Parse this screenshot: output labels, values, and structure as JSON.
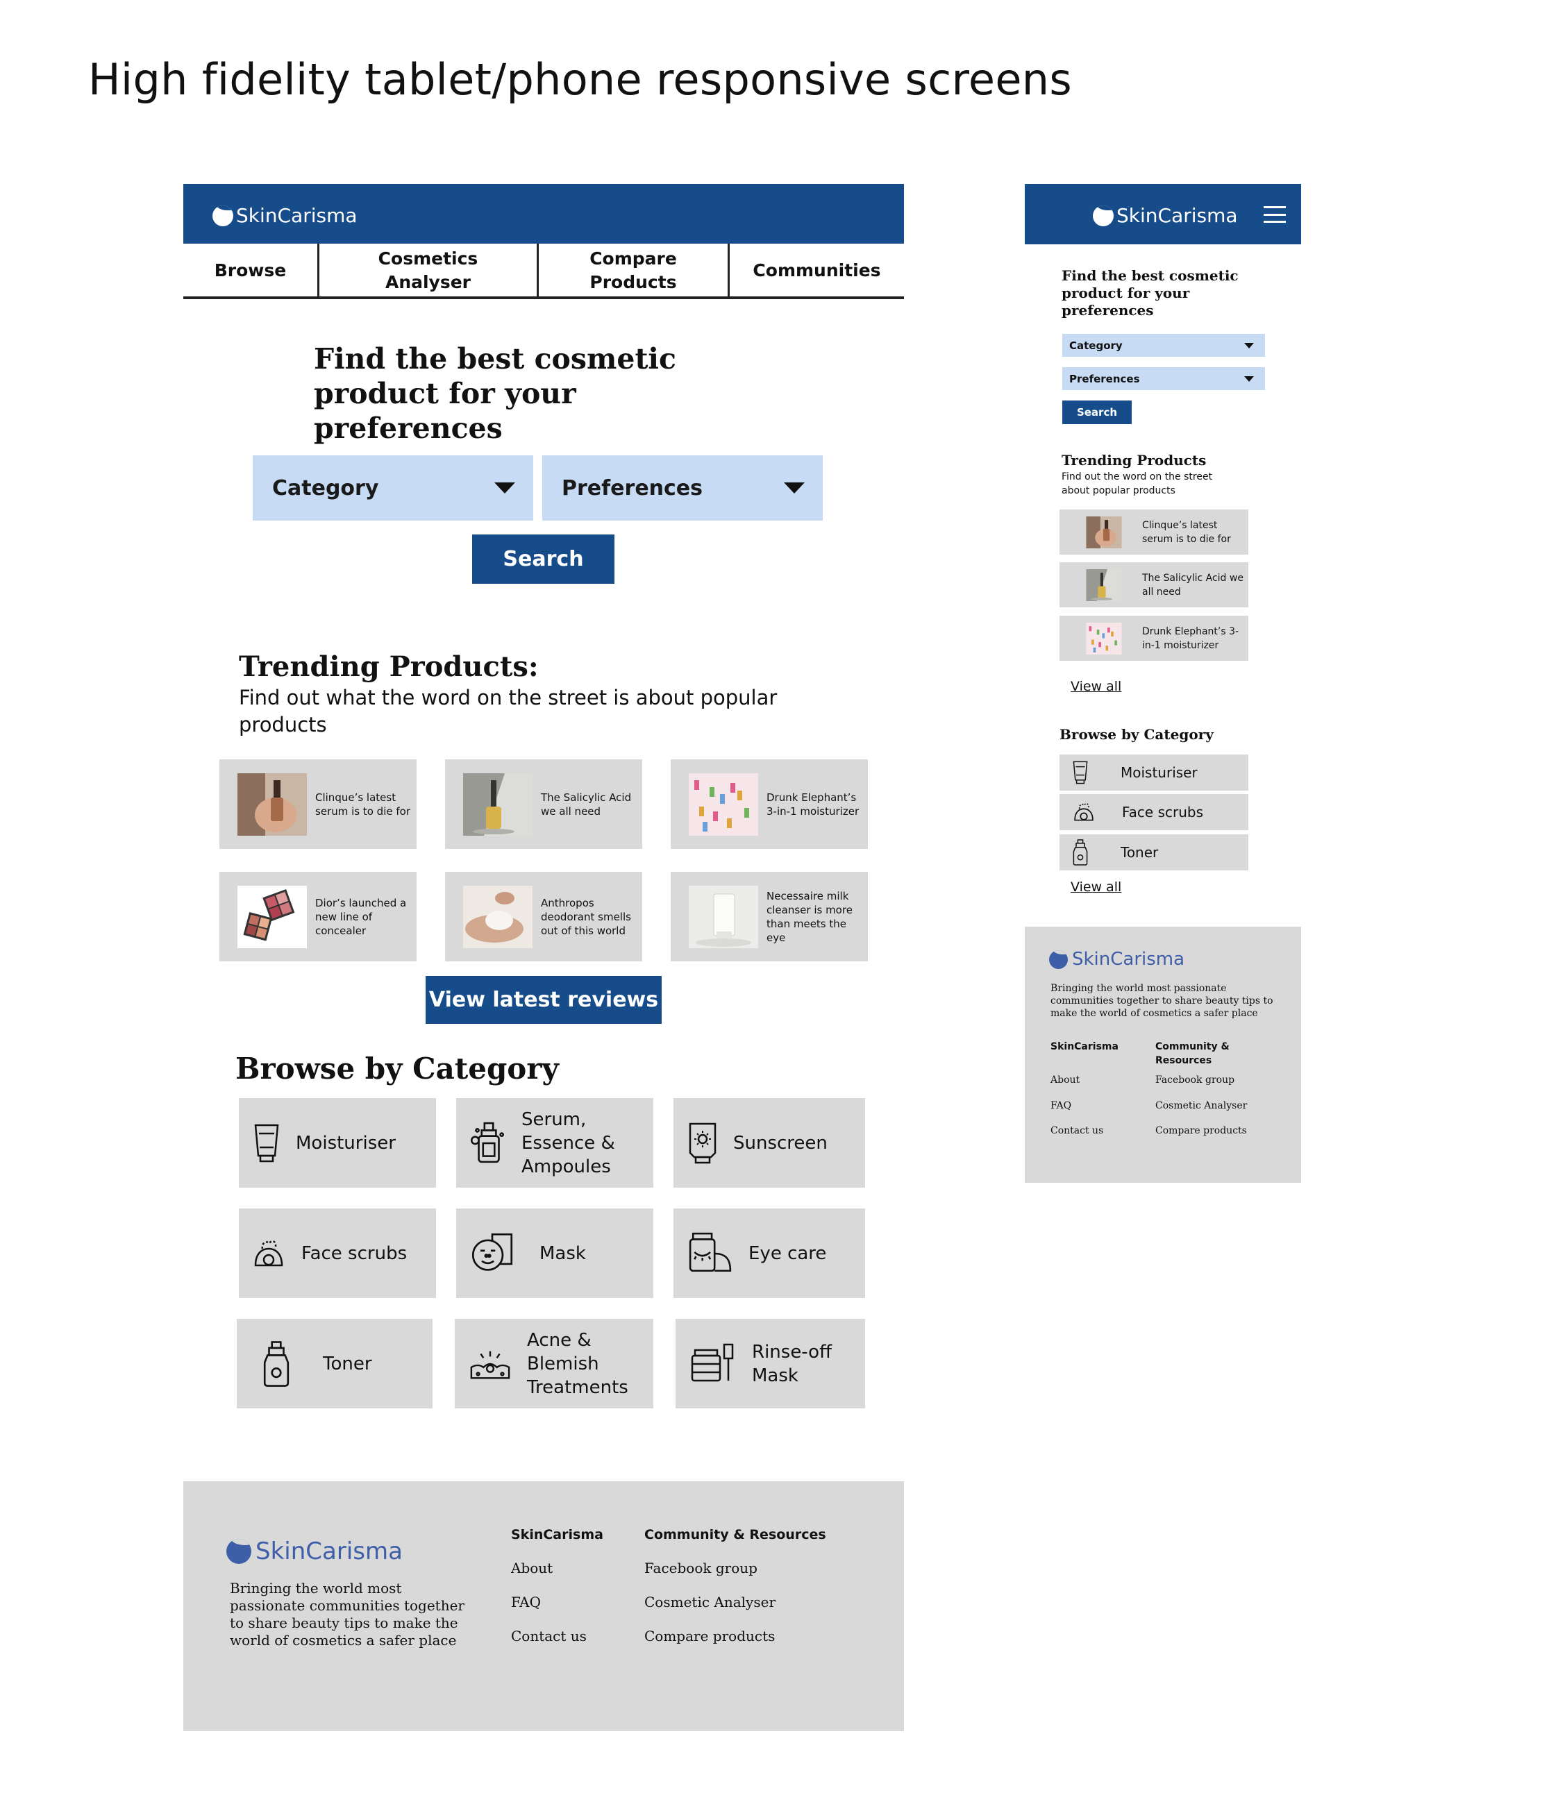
{
  "page_heading": "High fidelity tablet/phone responsive screens",
  "brand": "SkinCarisma",
  "colors": {
    "primary": "#174c8b",
    "select_bg": "#c7dcf4",
    "card_bg": "#d9d9d9",
    "footer_logo": "#3f5ea8"
  },
  "tablet": {
    "nav": [
      "Browse",
      "Cosmetics Analyser",
      "Compare Products",
      "Communities"
    ],
    "hero": "Find the best cosmetic product for your preferences",
    "category_select": "Category",
    "preferences_select": "Preferences",
    "search_label": "Search",
    "trending_title": "Trending Products:",
    "trending_subtitle": "Find out what the word on the street is about popular products",
    "trending": [
      {
        "text": "Clinque’s latest serum is to die for",
        "image": "serum-hand"
      },
      {
        "text": "The Salicylic Acid we all need",
        "image": "dropper-bottle"
      },
      {
        "text": "Drunk Elephant’s 3-in-1 moisturizer",
        "image": "pink-bottles"
      },
      {
        "text": "Dior’s launched a new line of concealer",
        "image": "concealer-palettes"
      },
      {
        "text": "Anthropos deodorant smells out of this world",
        "image": "cream-hand"
      },
      {
        "text": "Necessaire milk cleanser is more than meets the eye",
        "image": "white-tube"
      }
    ],
    "view_reviews_label": "View latest reviews",
    "browse_title": "Browse by Category",
    "categories": [
      {
        "label": "Moisturiser",
        "icon": "moisturiser-tube-icon"
      },
      {
        "label": "Serum, Essence & Ampoules",
        "icon": "serum-bottle-icon"
      },
      {
        "label": "Sunscreen",
        "icon": "sunscreen-icon"
      },
      {
        "label": "Face scrubs",
        "icon": "face-scrub-icon"
      },
      {
        "label": "Mask",
        "icon": "face-mask-icon"
      },
      {
        "label": "Eye care",
        "icon": "eye-care-jar-icon"
      },
      {
        "label": "Toner",
        "icon": "toner-bottle-icon"
      },
      {
        "label": "Acne & Blemish Treatments",
        "icon": "acne-treatment-icon"
      },
      {
        "label": "Rinse-off Mask",
        "icon": "rinse-off-mask-icon"
      }
    ],
    "footer": {
      "tagline": "Bringing the world most passionate communities together to share beauty tips to make the world of cosmetics a safer place",
      "col1_title": "SkinCarisma",
      "col1_links": [
        "About",
        "FAQ",
        "Contact us"
      ],
      "col2_title": "Community & Resources",
      "col2_links": [
        "Facebook group",
        "Cosmetic Analyser",
        "Compare products"
      ]
    }
  },
  "phone": {
    "hero": "Find the best cosmetic product for your preferences",
    "category_select": "Category",
    "preferences_select": "Preferences",
    "search_label": "Search",
    "trending_title": "Trending Products",
    "trending_subtitle": "Find out the word on the street about popular products",
    "trending": [
      {
        "text": "Clinque’s latest serum is to die for",
        "image": "serum-hand"
      },
      {
        "text": "The Salicylic Acid we all need",
        "image": "dropper-bottle"
      },
      {
        "text": "Drunk Elephant’s 3-in-1 moisturizer",
        "image": "pink-bottles"
      }
    ],
    "view_all_1": "View all",
    "browse_title": "Browse by Category",
    "categories": [
      {
        "label": "Moisturiser",
        "icon": "moisturiser-tube-icon"
      },
      {
        "label": "Face scrubs",
        "icon": "face-scrub-icon"
      },
      {
        "label": "Toner",
        "icon": "toner-bottle-icon"
      }
    ],
    "view_all_2": "View all",
    "footer": {
      "tagline": "Bringing the world most passionate communities together to share beauty tips to make the world of cosmetics a safer place",
      "col1_title": "SkinCarisma",
      "col1_links": [
        "About",
        "FAQ",
        "Contact us"
      ],
      "col2_title": "Community & Resources",
      "col2_links": [
        "Facebook group",
        "Cosmetic Analyser",
        "Compare products"
      ]
    }
  }
}
